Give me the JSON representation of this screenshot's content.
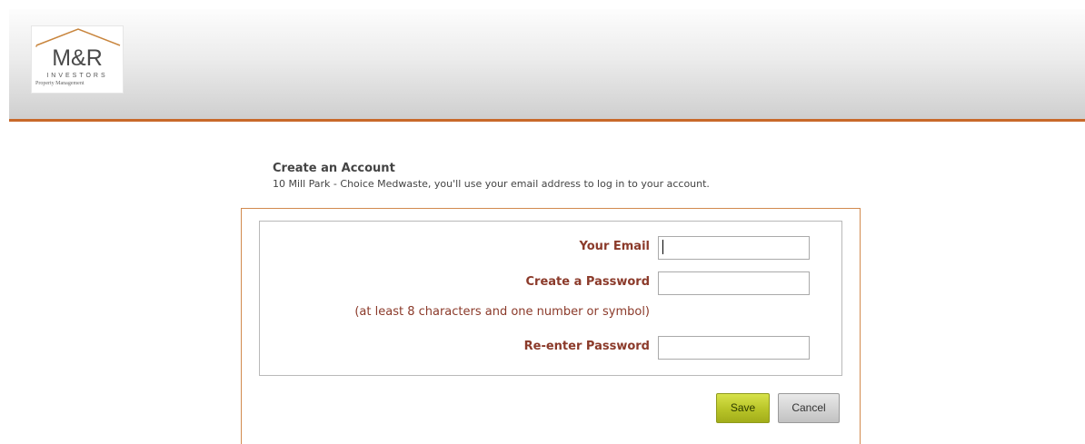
{
  "logo": {
    "mark": "M&R",
    "word": "INVESTORS",
    "sub": "Property Management"
  },
  "intro": {
    "title": "Create an Account",
    "description": "10 Mill Park - Choice Medwaste, you'll use your email address to log in to your account."
  },
  "form": {
    "email_label": "Your Email",
    "email_value": "",
    "password_label": "Create a Password",
    "password_value": "",
    "password_hint": "(at least 8 characters and one number or symbol)",
    "reenter_label": "Re-enter Password",
    "reenter_value": ""
  },
  "actions": {
    "save_label": "Save",
    "cancel_label": "Cancel"
  },
  "colors": {
    "accent": "#c8692a",
    "label": "#8b3a2a",
    "save_button": "#b8c428"
  }
}
